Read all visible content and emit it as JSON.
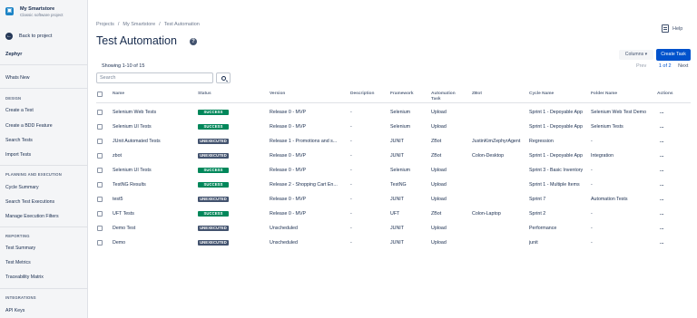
{
  "project": {
    "name": "My Smartstore",
    "type": "Classic software project",
    "logo_icon": "cart-icon"
  },
  "sidebar": {
    "back": "Back to project",
    "app_title": "Zephyr",
    "whats_new": "Whats New",
    "sections": [
      {
        "title": "DESIGN",
        "items": [
          "Create a Test",
          "Create a BDD Feature",
          "Search Tests",
          "Import Tests"
        ]
      },
      {
        "title": "PLANNING AND EXECUTION",
        "items": [
          "Cycle Summary",
          "Search Test Executions",
          "Manage Execution Filters"
        ]
      },
      {
        "title": "REPORTING",
        "items": [
          "Test Summary",
          "Test Metrics",
          "Traceability Matrix"
        ]
      },
      {
        "title": "INTEGRATIONS",
        "items": [
          "API Keys"
        ]
      }
    ]
  },
  "breadcrumb": [
    "Projects",
    "My Smartstore",
    "Test Automation"
  ],
  "breadcrumb_sep": "/",
  "page_title": "Test Automation",
  "help_label": "Help",
  "toolbar": {
    "columns": "Columns",
    "create": "Create Task"
  },
  "pagination": {
    "prev": "Prev",
    "current": "1 of 2",
    "next": "Next"
  },
  "showing": "Showing 1-10 of 15",
  "search": {
    "placeholder": "Search"
  },
  "table": {
    "columns": [
      "Name",
      "Status",
      "Version",
      "Description",
      "Framework",
      "Automation Task",
      "ZBot",
      "Cycle Name",
      "Folder Name",
      "Actions"
    ],
    "rows": [
      {
        "name": "Selenium Web Tests",
        "status": "SUCCESS",
        "version": "Release 0 - MVP",
        "description": "-",
        "framework": "Selenium",
        "task": "Upload",
        "zbot": "",
        "cycle": "Sprint 1 - Depoyable App",
        "folder": "Selenium Web Test Demo",
        "actions": "..."
      },
      {
        "name": "Selenium UI Tests",
        "status": "SUCCESS",
        "version": "Release 0 - MVP",
        "description": "-",
        "framework": "Selenium",
        "task": "Upload",
        "zbot": "",
        "cycle": "Sprint 1 - Depoyable App",
        "folder": "Selenium Tests",
        "actions": "..."
      },
      {
        "name": "JUnit Automated Tests",
        "status": "UNEXECUTED",
        "version": "Release 1 - Promotions and s...",
        "description": "-",
        "framework": "JUNIT",
        "task": "ZBot",
        "zbot": "JustinKimZephyrAgent",
        "cycle": "Regression",
        "folder": "-",
        "actions": "..."
      },
      {
        "name": "zbot",
        "status": "UNEXECUTED",
        "version": "Release 0 - MVP",
        "description": "-",
        "framework": "JUNIT",
        "task": "ZBot",
        "zbot": "Colon-Desktop",
        "cycle": "Sprint 1 - Depoyable App",
        "folder": "Integration",
        "actions": "..."
      },
      {
        "name": "Selenium UI Tests",
        "status": "SUCCESS",
        "version": "Release 0 - MVP",
        "description": "-",
        "framework": "Selenium",
        "task": "Upload",
        "zbot": "",
        "cycle": "Sprint 3 - Basic Inventory",
        "folder": "-",
        "actions": "..."
      },
      {
        "name": "TestNG Results",
        "status": "SUCCESS",
        "version": "Release 2 - Shopping Cart En...",
        "description": "-",
        "framework": "TestNG",
        "task": "Upload",
        "zbot": "",
        "cycle": "Sprint 1 - Multiple Items",
        "folder": "-",
        "actions": "..."
      },
      {
        "name": "test5",
        "status": "UNEXECUTED",
        "version": "Release 0 - MVP",
        "description": "-",
        "framework": "JUNIT",
        "task": "Upload",
        "zbot": "",
        "cycle": "Sprint 7",
        "folder": "Automation Tests",
        "actions": "..."
      },
      {
        "name": "UFT Tests",
        "status": "SUCCESS",
        "version": "Release 0 - MVP",
        "description": "-",
        "framework": "UFT",
        "task": "ZBot",
        "zbot": "Colon-Laptop",
        "cycle": "Sprint 2",
        "folder": "-",
        "actions": "..."
      },
      {
        "name": "Demo Test",
        "status": "UNEXECUTED",
        "version": "Unscheduled",
        "description": "-",
        "framework": "JUNIT",
        "task": "Upload",
        "zbot": "",
        "cycle": "Performance",
        "folder": "-",
        "actions": "..."
      },
      {
        "name": "Demo",
        "status": "UNEXECUTED",
        "version": "Unscheduled",
        "description": "-",
        "framework": "JUNIT",
        "task": "Upload",
        "zbot": "",
        "cycle": "junit",
        "folder": "-",
        "actions": "..."
      }
    ]
  },
  "colors": {
    "success": "#00875a",
    "unexecuted": "#42526e",
    "primary": "#0052cc",
    "sidebar_bg": "#f4f5f7"
  }
}
